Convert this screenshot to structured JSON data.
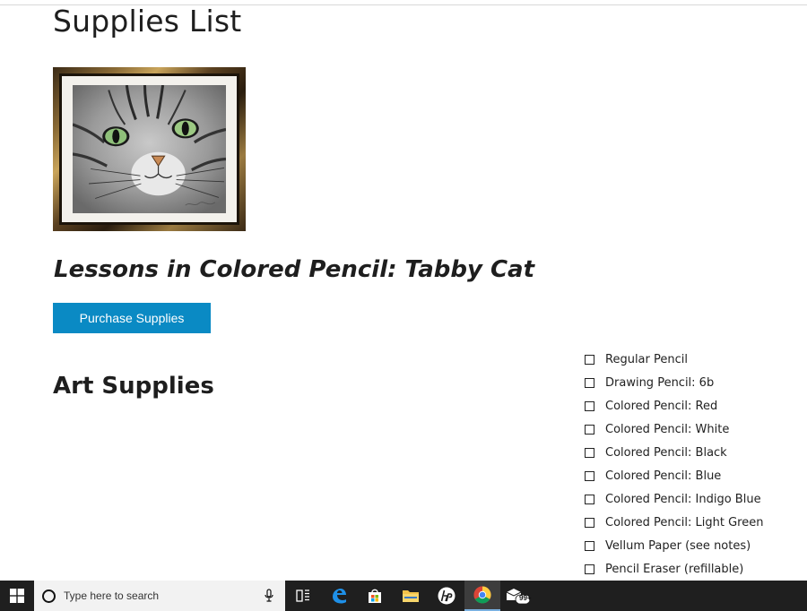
{
  "page": {
    "title": "Supplies List",
    "lesson_title": "Lessons in Colored Pencil: Tabby Cat",
    "purchase_label": "Purchase Supplies",
    "section_title": "Art Supplies"
  },
  "supplies": [
    "Regular Pencil",
    "Drawing Pencil: 6b",
    "Colored Pencil: Red",
    "Colored Pencil: White",
    "Colored Pencil: Black",
    "Colored Pencil: Blue",
    "Colored Pencil: Indigo Blue",
    "Colored Pencil: Light Green",
    "Vellum Paper (see notes)",
    "Pencil Eraser (refillable)"
  ],
  "taskbar": {
    "search_placeholder": "Type here to search",
    "mail_badge": "99+",
    "icons": [
      "windows-start-icon",
      "cortana-search-icon",
      "microphone-icon",
      "task-view-icon",
      "edge-icon",
      "store-icon",
      "file-explorer-icon",
      "hp-icon",
      "chrome-icon",
      "mail-icon"
    ]
  },
  "colors": {
    "accent": "#0a8ac4",
    "taskbar": "#1f1f1f"
  }
}
